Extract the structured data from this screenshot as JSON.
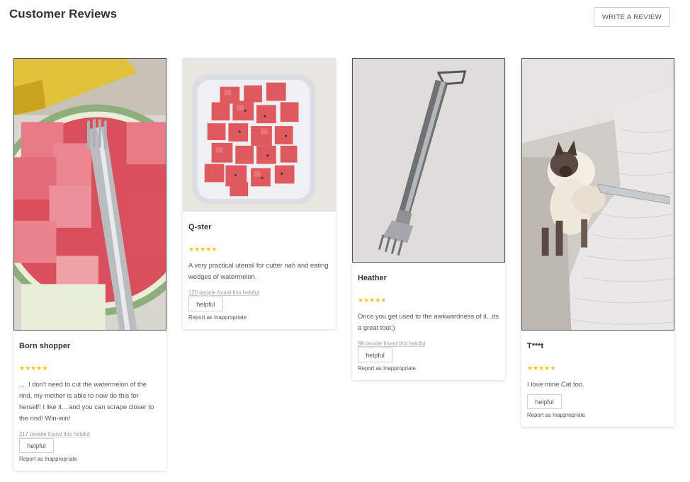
{
  "header": {
    "title": "Customer Reviews",
    "write_button": "WRITE A REVIEW"
  },
  "reviews": [
    {
      "photo": "watermelon-bowl-with-fork",
      "reviewer": "Born shopper",
      "rating": 5,
      "text": ".... I don't need to cut the watermelon of the rind, my mother is able to now do this for herself! I like it... and you can scrape closer to the rind! Win-win!",
      "helpful_count": "217 people found this helpful",
      "helpful_button": "helpful",
      "report": "Report as Inappropriate"
    },
    {
      "photo": "watermelon-cubes-container",
      "reviewer": "Q-ster",
      "rating": 5,
      "text": "A very practical utensil for cutter nah and eating wedges of watermelon.",
      "helpful_count": "120 people found this helpful",
      "helpful_button": "helpful",
      "report": "Report as Inappropriate"
    },
    {
      "photo": "fork-tool-on-table",
      "reviewer": "Heather",
      "rating": 5,
      "text": "Once you get used to the awkwardness of it...its a great tool;)",
      "helpful_count": "98 people found this helpful",
      "helpful_button": "helpful",
      "report": "Report as Inappropriate"
    },
    {
      "photo": "siamese-cat-on-bed",
      "reviewer": "T***t",
      "rating": 5,
      "text": "I love mine.Cat too.",
      "helpful_count": "",
      "helpful_button": "helpful",
      "report": "Report as Inappropriate"
    }
  ],
  "colors": {
    "star": "#f7c21a",
    "border": "#cfcfcf"
  }
}
